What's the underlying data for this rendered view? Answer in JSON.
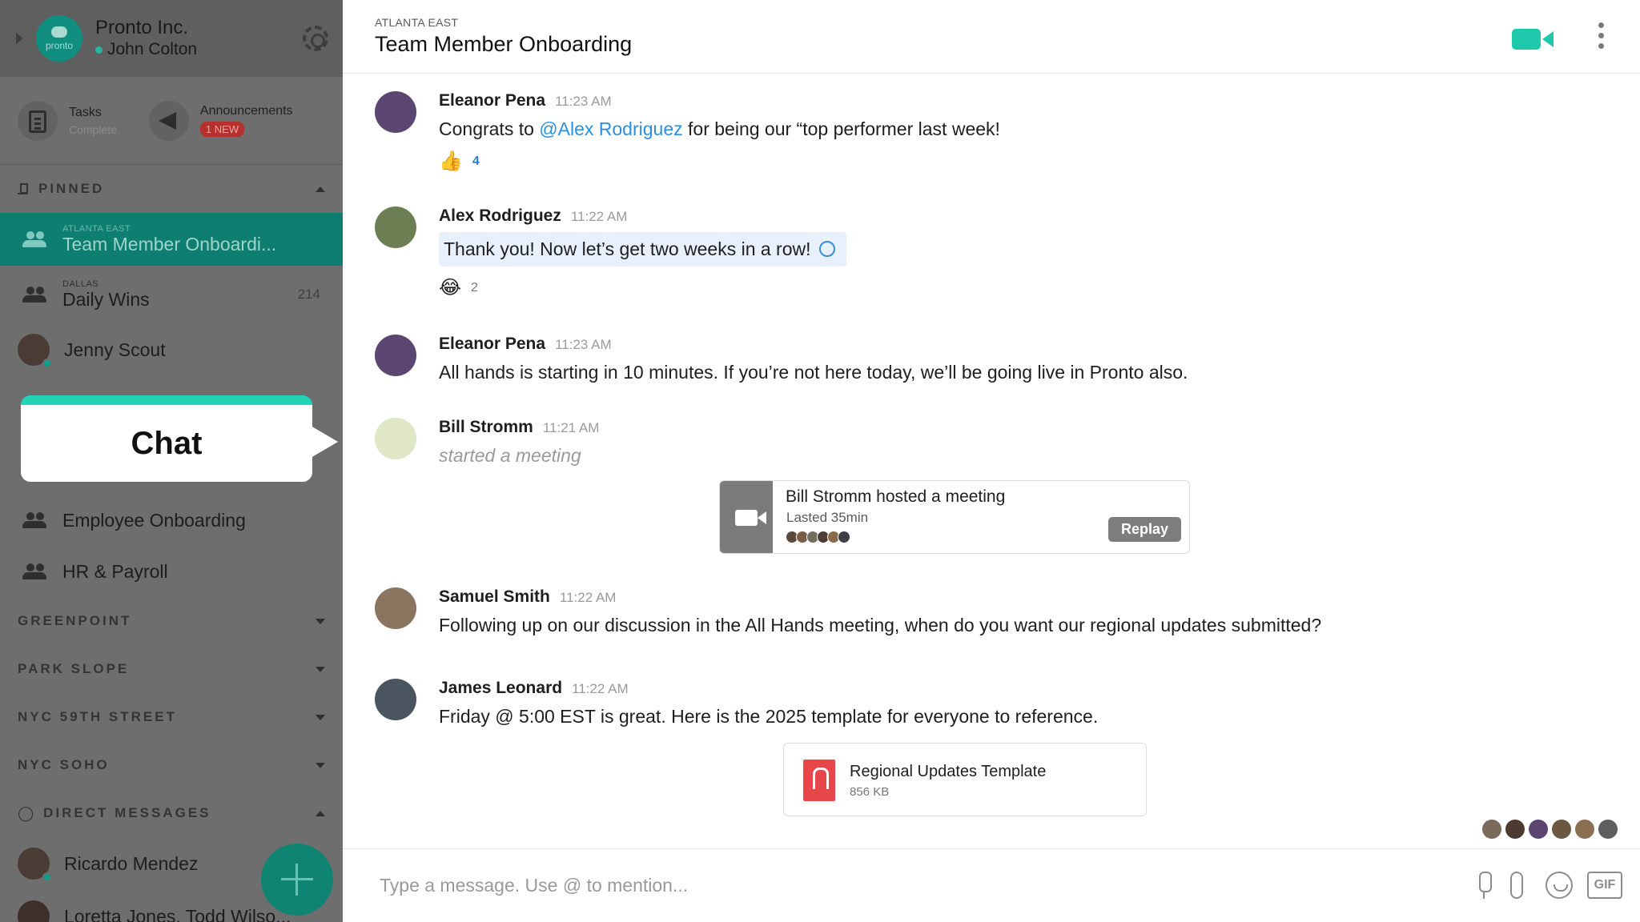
{
  "org": {
    "name": "Pronto Inc.",
    "user": "John Colton",
    "logo_text": "pronto"
  },
  "quick": [
    {
      "title": "Tasks",
      "sub": "Complete"
    },
    {
      "title": "Announcements",
      "badge": "1 NEW"
    }
  ],
  "sidebar": {
    "pinned_label": "PINNED",
    "pinned": [
      {
        "sub": "ATLANTA EAST",
        "name": "Team Member Onboardi...",
        "active": true
      },
      {
        "sub": "DALLAS",
        "name": "Daily Wins",
        "count": "214"
      },
      {
        "name": "Jenny Scout"
      }
    ],
    "channels": [
      {
        "name": "Employee Onboarding"
      },
      {
        "name": "HR & Payroll"
      }
    ],
    "sections": [
      "GREENPOINT",
      "PARK SLOPE",
      "NYC 59TH STREET",
      "NYC SOHO"
    ],
    "dm_label": "DIRECT MESSAGES",
    "dms": [
      {
        "name": "Ricardo Mendez"
      },
      {
        "name": "Loretta Jones, Todd Wilso..."
      }
    ]
  },
  "tooltip": "Chat",
  "header": {
    "sub": "ATLANTA EAST",
    "title": "Team Member Onboarding"
  },
  "messages": [
    {
      "author": "Eleanor Pena",
      "time": "11:23 AM",
      "pre": "Congrats to ",
      "mention": "@Alex Rodriguez",
      "post": " for being our “top performer last week!",
      "reaction_emoji": "👍",
      "reaction_count": "4"
    },
    {
      "author": "Alex Rodriguez",
      "time": "11:22 AM",
      "text": "Thank you! Now let’s get two weeks in a row!",
      "reaction_emoji": "😂",
      "reaction_count": "2"
    },
    {
      "author": "Eleanor Pena",
      "time": "11:23 AM",
      "text": "All hands is starting in 10 minutes. If you’re not here today, we’ll be going live in Pronto also."
    },
    {
      "author": "Bill Stromm",
      "time": "11:21 AM",
      "text": "started a meeting"
    },
    {
      "author": "Samuel Smith",
      "time": "11:22 AM",
      "text": "Following up on our discussion in the All Hands meeting, when do you want our regional updates submitted?"
    },
    {
      "author": "James Leonard",
      "time": "11:22 AM",
      "text": "Friday @ 5:00 EST is great. Here is the 2025 template for everyone to reference."
    }
  ],
  "meeting": {
    "title": "Bill Stromm hosted a meeting",
    "duration": "Lasted 35min",
    "replay": "Replay"
  },
  "file": {
    "name": "Regional Updates Template",
    "size": "856 KB"
  },
  "composer": {
    "placeholder": "Type a message. Use @ to mention...",
    "gif": "GIF"
  },
  "colors": {
    "brand": "#1ec8aa",
    "sidebar": "#6e6e6e",
    "active_channel": "#0e7e70",
    "mention": "#2a8fe0"
  }
}
